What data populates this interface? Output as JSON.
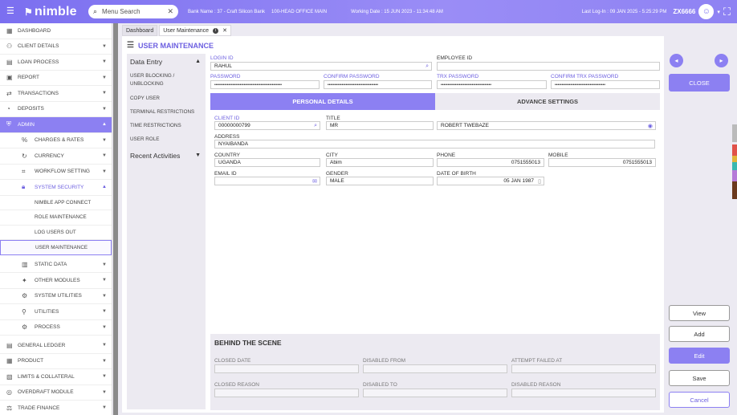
{
  "topbar": {
    "logo": "nimble",
    "search_placeholder": "Menu Search",
    "bank_name": "Bank Name : 37 - Craft Silicon Bank",
    "branch": "100-HEAD OFFICE MAIN",
    "working_date": "Working Date : 15 JUN 2023 - 11:34:48 AM",
    "last_login": "Last Log-In : 09 JAN 2025 - 5:25:29 PM",
    "user": "ZX6666"
  },
  "sidebar": {
    "items": [
      {
        "label": "DASHBOARD",
        "icon": "grid-icon"
      },
      {
        "label": "CLIENT DETAILS",
        "icon": "users-icon"
      },
      {
        "label": "LOAN PROCESS",
        "icon": "loan-icon"
      },
      {
        "label": "REPORT",
        "icon": "report-icon"
      },
      {
        "label": "TRANSACTIONS",
        "icon": "transfer-icon"
      },
      {
        "label": "DEPOSITS",
        "icon": "deposit-icon"
      },
      {
        "label": "ADMIN",
        "icon": "shield-icon"
      }
    ],
    "admin_sub": [
      {
        "label": "CHARGES & RATES",
        "icon": "percent-icon"
      },
      {
        "label": "CURRENCY",
        "icon": "currency-icon"
      },
      {
        "label": "WORKFLOW SETTING",
        "icon": "workflow-icon"
      },
      {
        "label": "SYSTEM SECURITY",
        "icon": "lock-icon"
      }
    ],
    "security_leaves": [
      "NIMBLE APP CONNECT",
      "ROLE MAINTENANCE",
      "LOG USERS OUT",
      "USER MAINTENANCE"
    ],
    "admin_sub2": [
      {
        "label": "STATIC DATA",
        "icon": "database-icon"
      },
      {
        "label": "OTHER MODULES",
        "icon": "modules-icon"
      },
      {
        "label": "SYSTEM UTILITIES",
        "icon": "tools-icon"
      },
      {
        "label": "UTILITIES",
        "icon": "utility-icon"
      },
      {
        "label": "PROCESS",
        "icon": "process-icon"
      }
    ],
    "items2": [
      {
        "label": "GENERAL LEDGER",
        "icon": "ledger-icon"
      },
      {
        "label": "PRODUCT",
        "icon": "product-icon"
      },
      {
        "label": "LIMITS & COLLATERAL",
        "icon": "limits-icon"
      },
      {
        "label": "OVERDRAFT MODULE",
        "icon": "overdraft-icon"
      },
      {
        "label": "TRADE FINANCE",
        "icon": "trade-icon"
      }
    ]
  },
  "tabs": [
    {
      "label": "Dashboard"
    },
    {
      "label": "User Maintenance"
    }
  ],
  "page": {
    "title": "USER MAINTENANCE"
  },
  "leftnav": {
    "data_entry": "Data Entry",
    "items": [
      "USER BLOCKING / UNBLOCKING",
      "COPY USER",
      "TERMINAL RESTRICTIONS",
      "TIME RESTRICTIONS",
      "USER ROLE"
    ],
    "recent": "Recent Activities"
  },
  "form": {
    "login_id": {
      "label": "LOGIN ID",
      "value": "RAHUL"
    },
    "employee_id": {
      "label": "EMPLOYEE ID",
      "value": ""
    },
    "password": {
      "label": "PASSWORD",
      "value": "••••••••••••••••••••••••••••••••••••••••••••••••"
    },
    "confirm_password": {
      "label": "CONFIRM PASSWORD",
      "value": "••••••••••••••••••••••••••••••••••••"
    },
    "trx_password": {
      "label": "TRX PASSWORD",
      "value": "••••••••••••••••••••••••••••••••••••"
    },
    "confirm_trx_password": {
      "label": "CONFIRM TRX PASSWORD",
      "value": "••••••••••••••••••••••••••••••••••••"
    },
    "section_tabs": [
      "PERSONAL DETAILS",
      "ADVANCE SETTINGS"
    ],
    "client_id": {
      "label": "CLIENT ID",
      "value": "00000000799"
    },
    "title": {
      "label": "TITLE",
      "value": "MR"
    },
    "name": "ROBERT TWEBAZE",
    "address": {
      "label": "ADDRESS",
      "value": "NYAIBANDA"
    },
    "country": {
      "label": "COUNTRY",
      "value": "UGANDA"
    },
    "city": {
      "label": "CITY",
      "value": "Abim"
    },
    "phone": {
      "label": "PHONE",
      "value": "0751555013"
    },
    "mobile": {
      "label": "MOBILE",
      "value": "0751555013"
    },
    "email": {
      "label": "EMAIL ID",
      "value": ""
    },
    "gender": {
      "label": "GENDER",
      "value": "MALE"
    },
    "dob": {
      "label": "DATE OF BIRTH",
      "value": "05 JAN 1987"
    }
  },
  "behind": {
    "title": "BEHIND THE SCENE",
    "labels": [
      "CLOSED DATE",
      "DISABLED FROM",
      "ATTEMPT FAILED AT",
      "CLOSED REASON",
      "DISABLED TO",
      "DISABLED REASON"
    ]
  },
  "actions": {
    "close": "CLOSE",
    "view": "View",
    "add": "Add",
    "edit": "Edit",
    "save": "Save",
    "cancel": "Cancel"
  },
  "colors": {
    "accent": "#8c80f2",
    "topbar": "#7b6ff0"
  }
}
